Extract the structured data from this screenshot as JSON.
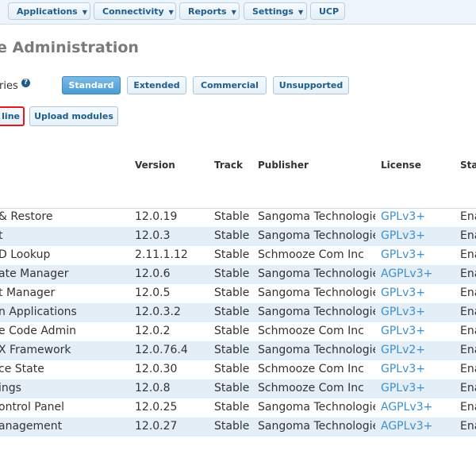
{
  "nav": {
    "items": [
      {
        "label": "Applications",
        "has_dropdown": true
      },
      {
        "label": "Connectivity",
        "has_dropdown": true
      },
      {
        "label": "Reports",
        "has_dropdown": true
      },
      {
        "label": "Settings",
        "has_dropdown": true
      },
      {
        "label": "UCP",
        "has_dropdown": false
      }
    ]
  },
  "page": {
    "title": "e Administration",
    "repositories_label": "ries",
    "help_icon_text": "?"
  },
  "repos": {
    "buttons": [
      {
        "label": "Standard",
        "active": true
      },
      {
        "label": "Extended",
        "active": false
      },
      {
        "label": "Commercial",
        "active": false
      },
      {
        "label": "Unsupported",
        "active": false
      }
    ]
  },
  "actions": {
    "check_online_label": "line",
    "upload_modules_label": "Upload modules"
  },
  "table": {
    "headers": {
      "version": "Version",
      "track": "Track",
      "publisher": "Publisher",
      "license": "License",
      "status": "Stat"
    },
    "rows": [
      {
        "name": " & Restore",
        "version": "12.0.19",
        "track": "Stable",
        "publisher": "Sangoma Technologie",
        "license": "GPLv3+",
        "status": "Ena"
      },
      {
        "name": "t",
        "version": "12.0.3",
        "track": "Stable",
        "publisher": "Sangoma Technologie",
        "license": "GPLv3+",
        "status": "Ena"
      },
      {
        "name": "D Lookup",
        "version": "2.11.1.12",
        "track": "Stable",
        "publisher": "Schmooze Com Inc",
        "license": "GPLv3+",
        "status": "Ena"
      },
      {
        "name": "ate Manager",
        "version": "12.0.6",
        "track": "Stable",
        "publisher": "Sangoma Technologie",
        "license": "AGPLv3+",
        "status": "Ena"
      },
      {
        "name": "t Manager",
        "version": "12.0.5",
        "track": "Stable",
        "publisher": "Sangoma Technologie",
        "license": "GPLv3+",
        "status": "Ena"
      },
      {
        "name": "n Applications",
        "version": "12.0.3.2",
        "track": "Stable",
        "publisher": "Sangoma Technologie",
        "license": "GPLv3+",
        "status": "Ena"
      },
      {
        "name": "e Code Admin",
        "version": "12.0.2",
        "track": "Stable",
        "publisher": "Schmooze Com Inc",
        "license": "GPLv3+",
        "status": "Ena"
      },
      {
        "name": "X Framework",
        "version": "12.0.76.4",
        "track": "Stable",
        "publisher": "Sangoma Technologie",
        "license": "GPLv2+",
        "status": "Ena"
      },
      {
        "name": "ce State",
        "version": "12.0.30",
        "track": "Stable",
        "publisher": "Schmooze Com Inc",
        "license": "GPLv3+",
        "status": "Ena"
      },
      {
        "name": "ings",
        "version": "12.0.8",
        "track": "Stable",
        "publisher": "Schmooze Com Inc",
        "license": "GPLv3+",
        "status": "Ena"
      },
      {
        "name": "ontrol Panel",
        "version": "12.0.25",
        "track": "Stable",
        "publisher": "Sangoma Technologie",
        "license": "AGPLv3+",
        "status": "Ena"
      },
      {
        "name": "anagement",
        "version": "12.0.27",
        "track": "Stable",
        "publisher": "Sangoma Technologie",
        "license": "AGPLv3+",
        "status": "Ena"
      }
    ]
  },
  "colors": {
    "accent": "#1f5c8b",
    "link": "#3d8fcf",
    "alt_row": "#e4eef6",
    "highlight_border": "#e01b1b"
  }
}
